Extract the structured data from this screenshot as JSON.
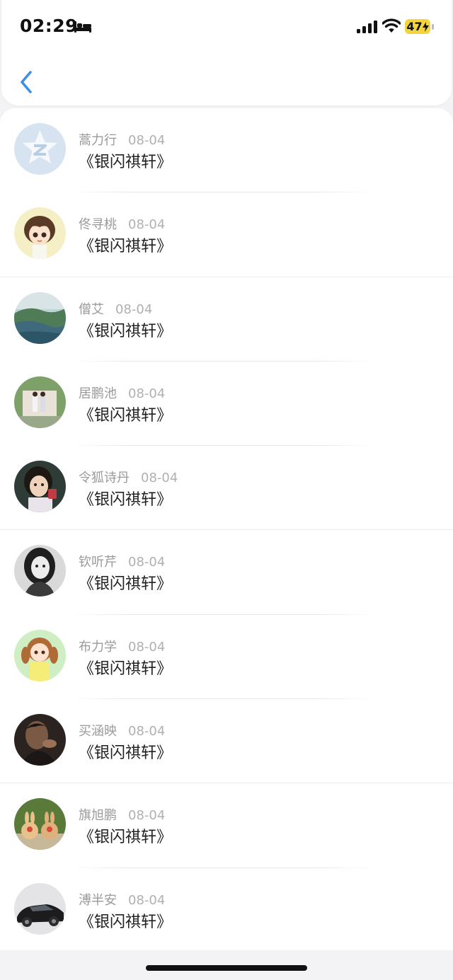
{
  "status_bar": {
    "time": "02:29",
    "battery": "47",
    "icons": [
      "bed-icon",
      "signal-icon",
      "wifi-icon",
      "battery-charging-icon"
    ]
  },
  "nav": {
    "back_icon": "chevron-left-icon",
    "accent": "#3a8fe6"
  },
  "list": {
    "items": [
      {
        "name": "蒿力行",
        "date": "08-04",
        "title": "《银闪祺轩》",
        "avatar": "qq-star-default-avatar"
      },
      {
        "name": "佟寻桃",
        "date": "08-04",
        "title": "《银闪祺轩》",
        "avatar": "cartoon-boy-avatar"
      },
      {
        "name": "僧艾",
        "date": "08-04",
        "title": "《银闪祺轩》",
        "avatar": "landscape-avatar"
      },
      {
        "name": "居鹏池",
        "date": "08-04",
        "title": "《银闪祺轩》",
        "avatar": "couple-photo-avatar"
      },
      {
        "name": "令狐诗丹",
        "date": "08-04",
        "title": "《银闪祺轩》",
        "avatar": "child-photo-avatar"
      },
      {
        "name": "钦听芹",
        "date": "08-04",
        "title": "《银闪祺轩》",
        "avatar": "girl-bw-avatar"
      },
      {
        "name": "布力学",
        "date": "08-04",
        "title": "《银闪祺轩》",
        "avatar": "cartoon-girl-avatar"
      },
      {
        "name": "买涵映",
        "date": "08-04",
        "title": "《银闪祺轩》",
        "avatar": "man-portrait-avatar"
      },
      {
        "name": "旗旭鹏",
        "date": "08-04",
        "title": "《银闪祺轩》",
        "avatar": "rabbit-figurines-avatar"
      },
      {
        "name": "溥半安",
        "date": "08-04",
        "title": "《银闪祺轩》",
        "avatar": "black-car-avatar"
      }
    ]
  }
}
